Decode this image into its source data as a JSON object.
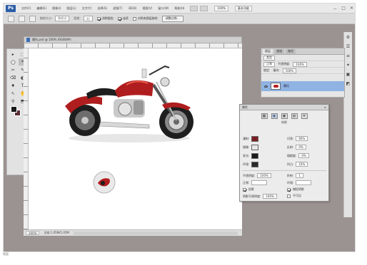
{
  "app": {
    "logo": "Ps",
    "menu": [
      "文件(F)",
      "编辑(E)",
      "图像(I)",
      "图层(L)",
      "文字(Y)",
      "选择(S)",
      "滤镜(T)",
      "3D(D)",
      "视图(V)",
      "窗口(W)",
      "帮助(H)"
    ],
    "zoom_value": "100%",
    "workspace": "基本功能",
    "window_controls": [
      "－",
      "□",
      "✕"
    ]
  },
  "options_bar": {
    "sample_label": "取样大小:",
    "sample_value": "取样点",
    "tolerance_label": "容差:",
    "tolerance_value": "32",
    "antialias_label": "消除锯齿",
    "contiguous_label": "连续",
    "all_layers_label": "对所有图层取样",
    "refine_button": "调整边缘..."
  },
  "toolbox": {
    "tools": [
      "▸",
      "⬚",
      "◯",
      "⌖",
      "✂",
      "✎",
      "⌫",
      "◐",
      "♦",
      "T",
      "↖",
      "✋",
      "⚲",
      "⬒"
    ]
  },
  "document": {
    "title": "摩托.psd @ 100% (RGB/8#)",
    "zoom": "100%",
    "doc_size": "文档:1.05M/1.05M"
  },
  "right_strip": {
    "icons": [
      "⚙",
      "☰",
      "≡",
      "✦",
      "▣",
      "◩"
    ]
  },
  "layers_panel": {
    "tabs": [
      "图层",
      "通道",
      "路径"
    ],
    "kind_label": "类型",
    "blend_mode": "正常",
    "opacity_label": "不透明度:",
    "opacity_value": "100%",
    "lock_label": "锁定:",
    "fill_label": "填充:",
    "fill_value": "100%",
    "layer_name": "摩托"
  },
  "materials_panel": {
    "header_title": "属性",
    "header_menu": "≡",
    "icons": [
      "▦",
      "◈",
      "◉",
      "◍",
      "✦"
    ],
    "sub_title": "材质",
    "diffuse_label": "漫射:",
    "specular_label": "镜像:",
    "illumination_label": "发光:",
    "ambient_label": "环境:",
    "shine_label": "闪亮:",
    "shine_value": "60%",
    "reflection_label": "反射:",
    "reflection_value": "0%",
    "roughness_label": "粗糙度:",
    "roughness_value": "0%",
    "bump_label": "凹凸:",
    "bump_value": "10%",
    "opacity_label": "不透明度:",
    "opacity_value": "100%",
    "refraction_label": "折射:",
    "refraction_value": "1",
    "normal_label": "正常:",
    "env_label": "环境:",
    "cast_shadow_label": "投影",
    "catch_shadow_label": "捕捉阴影",
    "invisible_label": "不可见",
    "shadow_opacity_label": "阴影不透明度:",
    "shadow_opacity_value": "100%",
    "ground_label": "地面",
    "diffuse_color": "#7a1e22",
    "specular_color": "#e6e6e6",
    "illumination_color": "#1a1a1a",
    "ambient_color": "#2a2a2a"
  },
  "colors": {
    "moto_red": "#b01d1e",
    "moto_dark": "#1e1e1e",
    "chrome": "#c9c9c9"
  }
}
